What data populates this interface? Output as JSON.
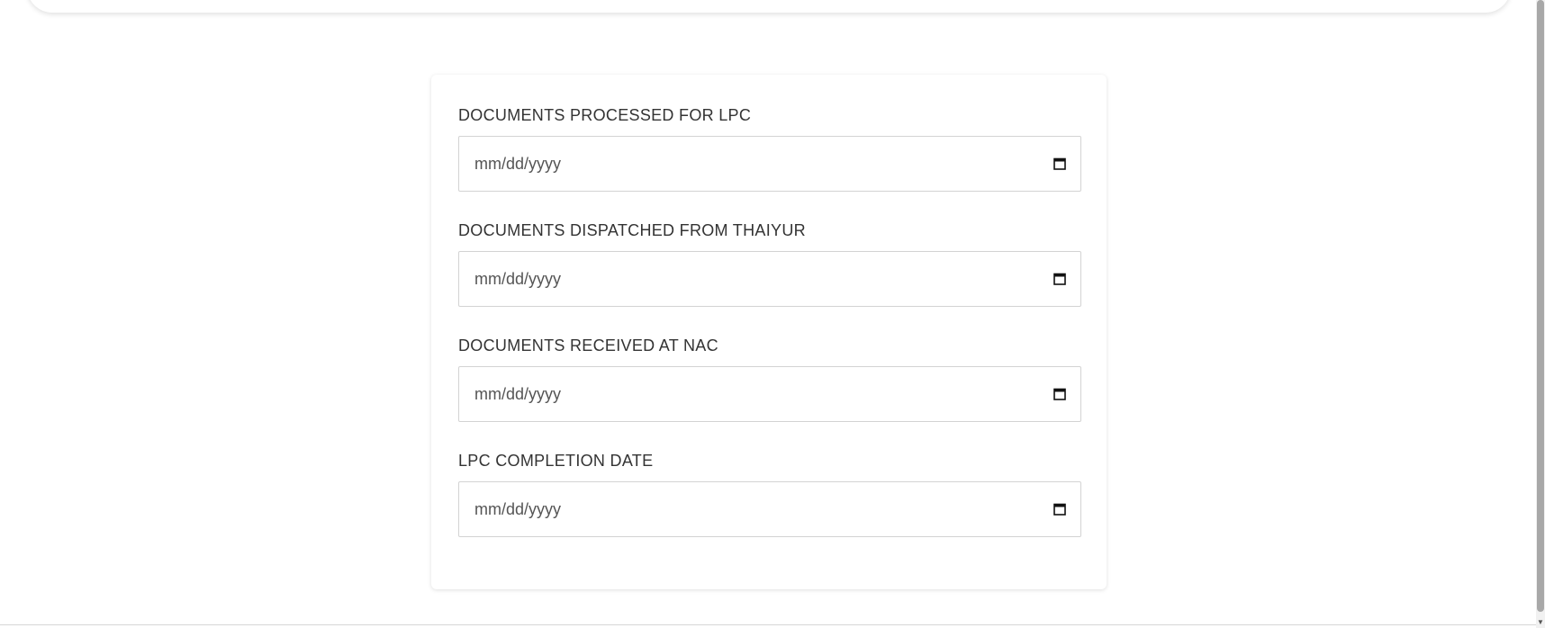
{
  "form": {
    "fields": [
      {
        "label": "DOCUMENTS PROCESSED FOR LPC",
        "placeholder": "mm/dd/yyyy",
        "value": ""
      },
      {
        "label": "DOCUMENTS DISPATCHED FROM THAIYUR",
        "placeholder": "mm/dd/yyyy",
        "value": ""
      },
      {
        "label": "DOCUMENTS RECEIVED AT NAC",
        "placeholder": "mm/dd/yyyy",
        "value": ""
      },
      {
        "label": "LPC COMPLETION DATE",
        "placeholder": "mm/dd/yyyy",
        "value": ""
      }
    ]
  },
  "icons": {
    "date_picker": "calendar-icon"
  }
}
